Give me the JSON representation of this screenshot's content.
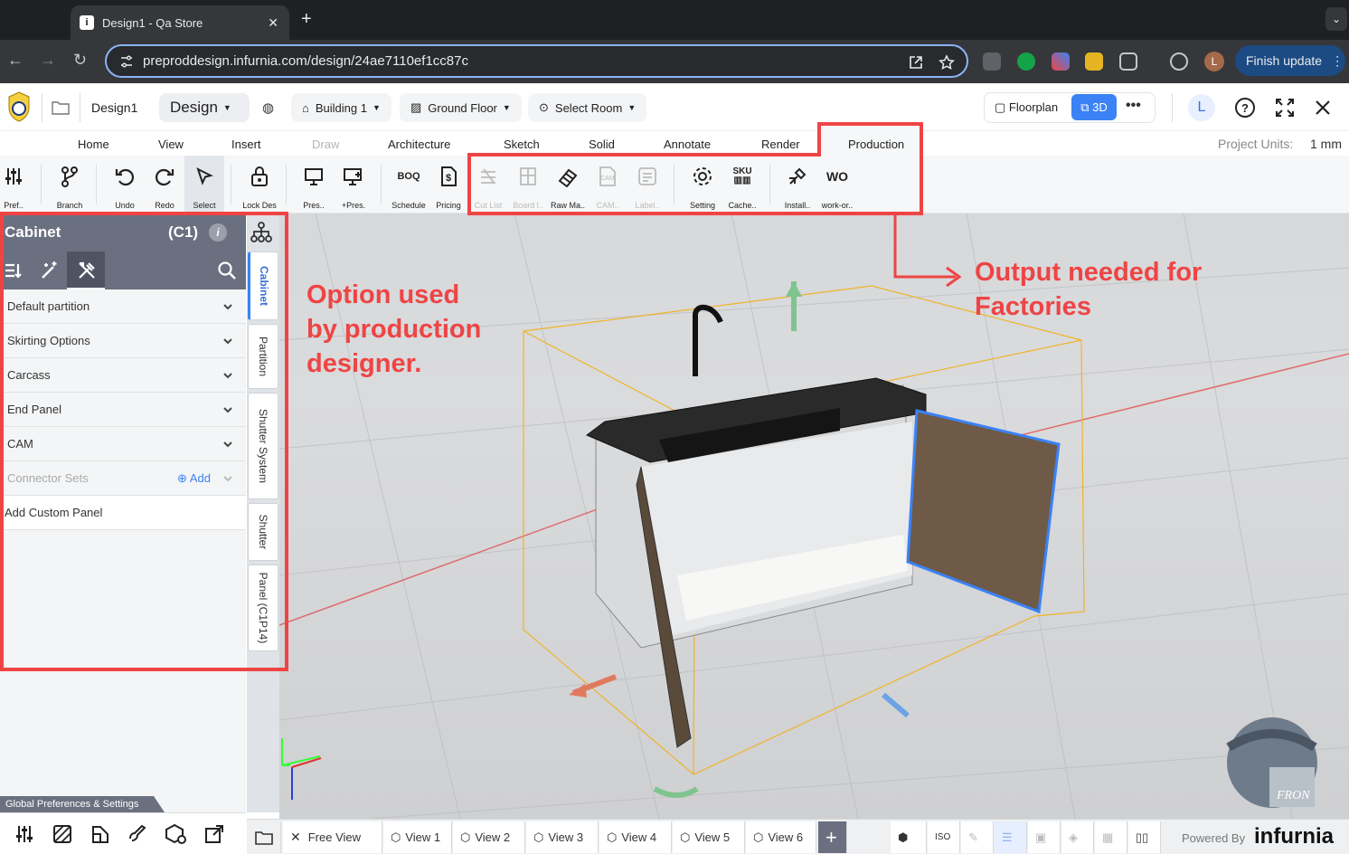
{
  "browser": {
    "tab_title": "Design1 - Qa Store",
    "url": "preproddesign.infurnia.com/design/24ae7110ef1cc87c",
    "profile_initial": "L",
    "finish_update": "Finish update"
  },
  "app": {
    "design_name": "Design1",
    "mode": "Design",
    "building": "Building 1",
    "floor": "Ground Floor",
    "room": "Select Room",
    "floorplan": "Floorplan",
    "view3d": "3D",
    "user_initial": "L",
    "project_units_label": "Project Units:",
    "project_units_value": "1 mm"
  },
  "ribbon": {
    "tabs": [
      "Home",
      "View",
      "Insert",
      "Draw",
      "Architecture",
      "Sketch",
      "Solid",
      "Annotate",
      "Render",
      "Production"
    ],
    "tools": [
      "Pref..",
      "Branch",
      "Undo",
      "Redo",
      "Select",
      "Lock Des",
      "Pres..",
      "+Pres.",
      "Schedule",
      "Pricing",
      "Cut List",
      "Board l..",
      "Raw Ma..",
      "CAM..",
      "Label..",
      "Setting",
      "Cache..",
      "Install..",
      "work-or.."
    ],
    "boq_icon_text": "BOQ",
    "sku_icon_text": "SKU",
    "wo_icon_text": "WO",
    "cam_icon_text": "CAM"
  },
  "left_panel": {
    "title": "Cabinet",
    "code": "(C1)",
    "rows": [
      "Default partition",
      "Skirting Options",
      "Carcass",
      "End Panel",
      "CAM",
      "Connector Sets",
      "Add Custom Panel"
    ],
    "add_label": "Add",
    "global_prefs": "Global Preferences & Settings"
  },
  "vertical_tabs": [
    "Cabinet",
    "Partition",
    "Shutter System",
    "Shutter",
    "Panel (C1P14)"
  ],
  "views": [
    "Free View",
    "View 1",
    "View 2",
    "View 3",
    "View 4",
    "View 5",
    "View 6"
  ],
  "powered_by": "Powered By",
  "brand": "infurnia",
  "compass_text": "FRON",
  "annotations": {
    "left": [
      "Option used",
      "by production",
      "designer."
    ],
    "right": [
      "Output needed for",
      "Factories"
    ]
  },
  "colors": {
    "annotation_red": "#ef4444",
    "accent_blue": "#3b82f6",
    "panel_gray": "#6b7080"
  }
}
